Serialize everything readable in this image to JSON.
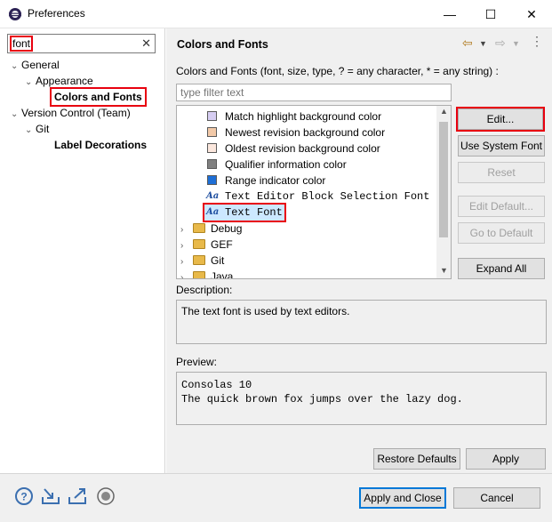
{
  "window": {
    "title": "Preferences",
    "minimize": "—",
    "maximize": "☐",
    "close": "✕"
  },
  "left": {
    "filter_value": "font",
    "tree": [
      {
        "label": "General",
        "level": 0,
        "expanded": true
      },
      {
        "label": "Appearance",
        "level": 1,
        "expanded": true
      },
      {
        "label": "Colors and Fonts",
        "level": 2,
        "selected": true
      },
      {
        "label": "Version Control (Team)",
        "level": 0,
        "expanded": true
      },
      {
        "label": "Git",
        "level": 1,
        "expanded": true
      },
      {
        "label": "Label Decorations",
        "level": 2
      }
    ]
  },
  "page": {
    "title": "Colors and Fonts",
    "description": "Colors and Fonts (font, size, type, ? = any character, * = any string) :",
    "filter_placeholder": "type filter text",
    "items": [
      {
        "label": "Match highlight background color",
        "kind": "color",
        "color": "#d6cdf2"
      },
      {
        "label": "Newest revision background color",
        "kind": "color",
        "color": "#f2c9a8"
      },
      {
        "label": "Oldest revision background color",
        "kind": "color",
        "color": "#fbe7dd"
      },
      {
        "label": "Qualifier information color",
        "kind": "color",
        "color": "#808080"
      },
      {
        "label": "Range indicator color",
        "kind": "color",
        "color": "#1e6fd6"
      },
      {
        "label": "Text Editor Block Selection Font",
        "kind": "font"
      },
      {
        "label": "Text Font",
        "kind": "font",
        "selected": true
      },
      {
        "label": "Debug",
        "kind": "folder"
      },
      {
        "label": "GEF",
        "kind": "folder"
      },
      {
        "label": "Git",
        "kind": "folder"
      },
      {
        "label": "Java",
        "kind": "folder"
      }
    ],
    "buttons": {
      "edit": "Edit...",
      "use_system_font": "Use System Font",
      "reset": "Reset",
      "edit_default": "Edit Default...",
      "go_to_default": "Go to Default",
      "expand_all": "Expand All"
    },
    "description_label": "Description:",
    "description_text": "The text font is used by text editors.",
    "preview_label": "Preview:",
    "preview_lines": [
      "Consolas 10",
      "The quick brown fox jumps over the lazy dog."
    ],
    "restore_defaults": "Restore Defaults",
    "apply": "Apply"
  },
  "footer": {
    "apply_and_close": "Apply and Close",
    "cancel": "Cancel",
    "icons": [
      "help-icon",
      "import-icon",
      "export-icon",
      "record-icon"
    ]
  },
  "colors": {
    "highlight_red": "#e8000f",
    "accent": "#0078d7",
    "selection": "#cce8ff"
  }
}
